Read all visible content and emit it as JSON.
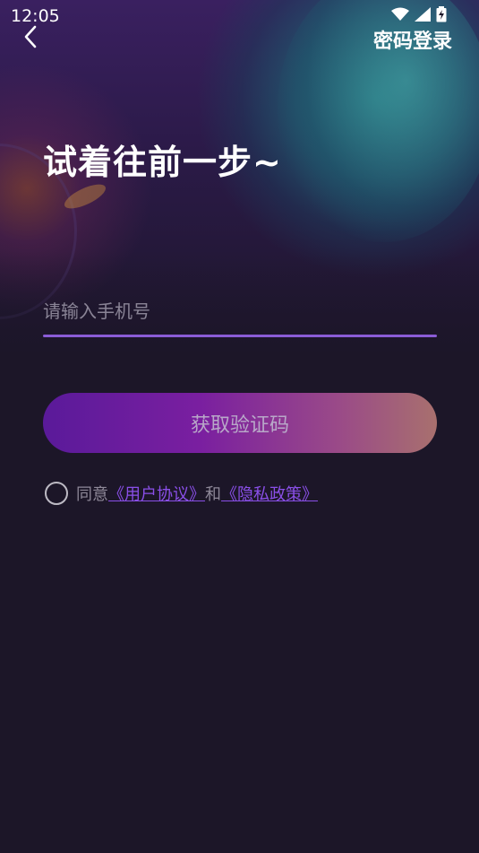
{
  "status_bar": {
    "time": "12:05"
  },
  "header": {
    "password_login_label": "密码登录"
  },
  "main": {
    "headline": "试着往前一步~",
    "phone": {
      "placeholder": "请输入手机号",
      "value": ""
    },
    "get_code_label": "获取验证码",
    "agreement": {
      "prefix": "同意",
      "user_agreement": "《用户协议》",
      "conjunction": "和",
      "privacy_policy": "《隐私政策》"
    }
  },
  "colors": {
    "background": "#1c1628",
    "accent_line": "#8b5cd6",
    "link": "#8a4fe8",
    "button_gradient_start": "#5a1a9a",
    "button_gradient_end": "#a8706e"
  }
}
